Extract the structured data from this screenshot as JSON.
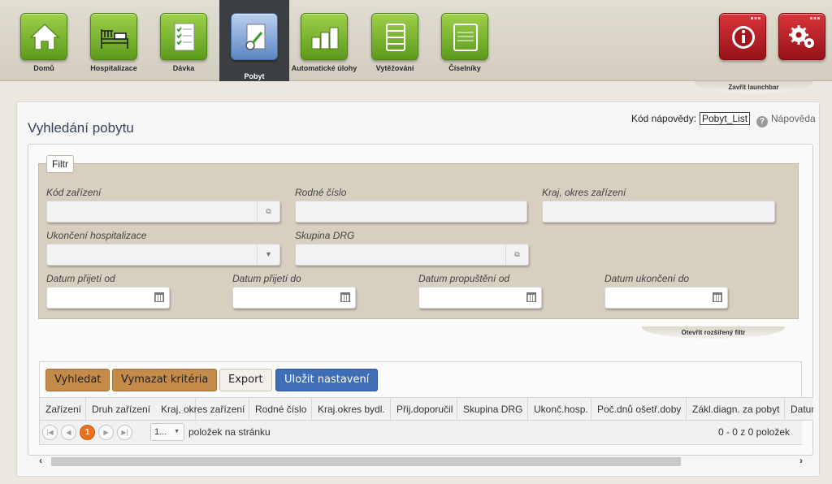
{
  "launchbar": {
    "tiles": [
      {
        "label": "Domů",
        "icon": "home-icon"
      },
      {
        "label": "Hospitalizace",
        "icon": "bed-icon"
      },
      {
        "label": "Dávka",
        "icon": "checklist-icon"
      },
      {
        "label": "Pobyt",
        "icon": "document-icon",
        "active": true
      },
      {
        "label": "Automatické úlohy",
        "icon": "blocks-icon"
      },
      {
        "label": "Vytěžování",
        "icon": "layers-icon"
      },
      {
        "label": "Číselníky",
        "icon": "codes-icon"
      }
    ],
    "right_tiles": [
      {
        "icon": "info-icon"
      },
      {
        "icon": "gears-icon"
      }
    ],
    "close_label": "Zavřít launchbar",
    "accent_green": "#7bb82e",
    "accent_red": "#b8202a",
    "active_bg": "#3c3f41"
  },
  "page": {
    "title": "Vyhledání pobytu",
    "help_code_label": "Kód nápovědy:",
    "help_code_value": "Pobyt_List",
    "help_link": "Nápověda"
  },
  "filter": {
    "legend": "Filtr",
    "labels": {
      "kod_zarizeni": "Kód zařízení",
      "rodne_cislo": "Rodné číslo",
      "kraj_okres": "Kraj, okres zařízení",
      "ukonceni": "Ukončení hospitalizace",
      "skupina_drg": "Skupina DRG",
      "prijeti_od": "Datum přijetí od",
      "prijeti_do": "Datum přijetí do",
      "propusteni_od": "Datum propuštění od",
      "ukonceni_do": "Datum ukončení do"
    },
    "open_extended": "Otevřít rozšířený filtr"
  },
  "toolbar": {
    "search": "Vyhledat",
    "clear": "Vymazat kritéria",
    "export": "Export",
    "save": "Uložit nastavení"
  },
  "grid": {
    "columns": [
      "Zařízení",
      "Druh zařízení",
      "Kraj, okres zařízení",
      "Rodné číslo",
      "Kraj.okres bydl.",
      "Přij.doporučil",
      "Skupina DRG",
      "Ukonč.hosp.",
      "Poč.dnů ošetř.doby",
      "Zákl.diagn. za pobyt",
      "Datum"
    ],
    "pager": {
      "current_page": "1",
      "page_size": "1...",
      "page_size_label": "položek na stránku",
      "info": "0 - 0 z 0 položek"
    }
  }
}
